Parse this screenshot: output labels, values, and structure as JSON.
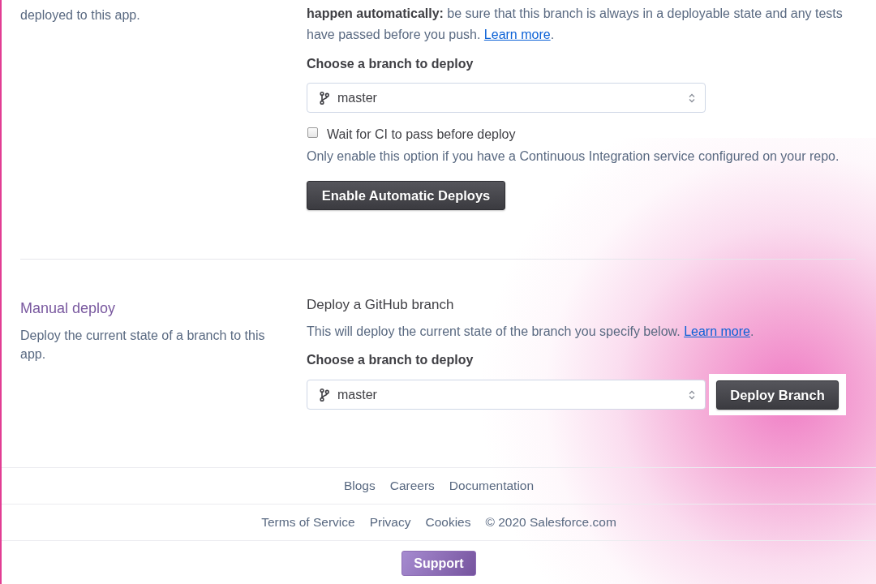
{
  "auto_deploy": {
    "description": "deployed to this app.",
    "notice": {
      "text": "**happen automatically:** be sure that this branch is always in a deployable state and any tests have passed before you push.",
      "link": "Learn more",
      "after_link": "."
    },
    "branch_label": "Choose a branch to deploy",
    "branch_select": {
      "value": "master"
    },
    "ci_checkbox": {
      "label": "Wait for CI to pass before deploy",
      "checked": false
    },
    "ci_help": "Only enable this option if you have a Continuous Integration service configured on your repo.",
    "button": {
      "label": "Enable Automatic Deploys"
    }
  },
  "manual_deploy": {
    "title": "Manual deploy",
    "description": "Deploy the current state of a branch to this app.",
    "heading": "Deploy a GitHub branch",
    "notice": {
      "text": "This will deploy the current state of the branch you specify below.",
      "link": "Learn more",
      "after_link": "."
    },
    "branch_label": "Choose a branch to deploy",
    "branch_select": {
      "value": "master"
    },
    "button": {
      "label": "Deploy Branch",
      "highlighted": true
    }
  },
  "footer": {
    "links": [
      "Blogs",
      "Careers",
      "Documentation"
    ],
    "legal_links": [
      "Terms of Service",
      "Privacy",
      "Cookies"
    ],
    "copyright": "© 2020 Salesforce.com",
    "support_button": "Support"
  }
}
